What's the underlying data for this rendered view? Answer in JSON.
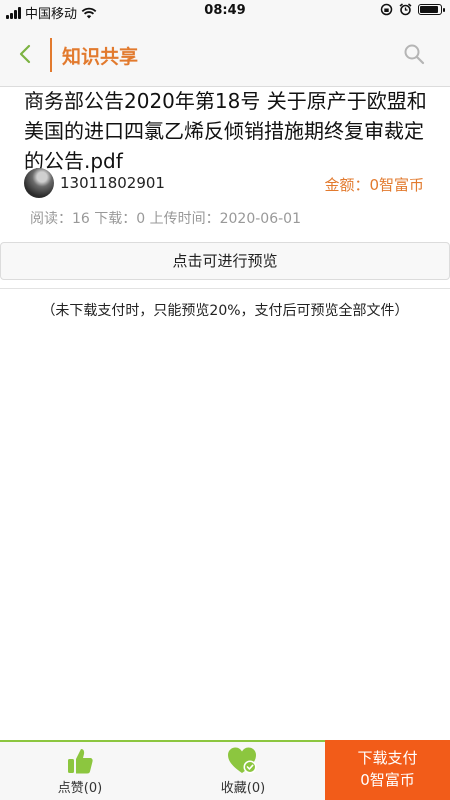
{
  "status_bar": {
    "carrier": "中国移动",
    "time": "08:49",
    "battery_level": 0.95
  },
  "nav": {
    "title": "知识共享",
    "icons": [
      "back-chevron-icon",
      "search-icon"
    ]
  },
  "document": {
    "title": "商务部公告2020年第18号 关于原产于欧盟和美国的进口四氯乙烯反倾销措施期终复审裁定的公告.pdf",
    "uploader": "13011802901",
    "price": "金额：0智富币",
    "meta": "阅读：16  下载：0  上传时间：2020-06-01"
  },
  "preview": {
    "button_label": "点击可进行预览",
    "notice": "（未下载支付时，只能预览20%，支付后可预览全部文件）"
  },
  "bottom_bar": {
    "like_label": "点赞(0)",
    "favorite_label": "收藏(0)",
    "pay_line1": "下载支付",
    "pay_line2": "0智富币"
  },
  "colors": {
    "accent": "#e27a2e",
    "pay_button": "#f25c19",
    "icon_green": "#8cc63f"
  }
}
